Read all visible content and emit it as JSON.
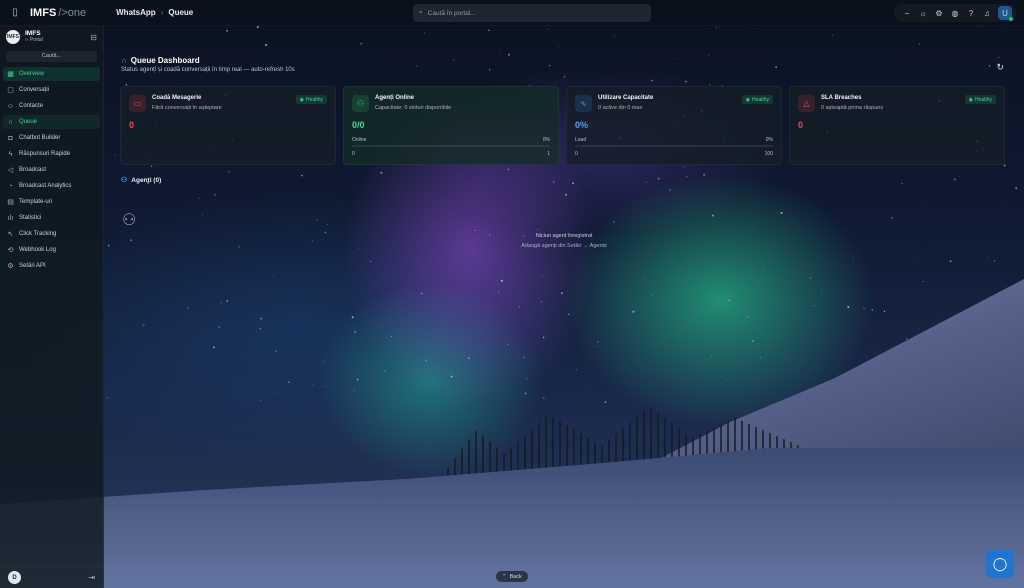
{
  "topbar": {
    "logo_main": "IMFS",
    "logo_suffix": "/>one",
    "breadcrumb": [
      "WhatsApp",
      "Queue"
    ],
    "search_placeholder": "Caută în portal..."
  },
  "sidebar": {
    "brand_name": "IMFS",
    "brand_logo_text": "IMFS",
    "brand_sub": "Portal",
    "search_label": "Caută...",
    "items": [
      {
        "label": "Overview",
        "icon": "grid-icon"
      },
      {
        "label": "Conversații",
        "icon": "chat-icon"
      },
      {
        "label": "Contacte",
        "icon": "contacts-icon"
      },
      {
        "label": "Queue",
        "icon": "headset-icon"
      },
      {
        "label": "Chatbot Builder",
        "icon": "bot-icon"
      },
      {
        "label": "Răspunsuri Rapide",
        "icon": "bolt-icon"
      },
      {
        "label": "Broadcast",
        "icon": "megaphone-icon"
      },
      {
        "label": "Broadcast Analytics",
        "icon": "analytics-icon"
      },
      {
        "label": "Template-uri",
        "icon": "document-icon"
      },
      {
        "label": "Statistici",
        "icon": "bar-chart-icon"
      },
      {
        "label": "Click Tracking",
        "icon": "cursor-icon"
      },
      {
        "label": "Webhook Log",
        "icon": "webhook-icon"
      },
      {
        "label": "Setări API",
        "icon": "settings-icon"
      }
    ],
    "user_initial": "D"
  },
  "user": {
    "initial": "U"
  },
  "dashboard": {
    "title": "Queue Dashboard",
    "subtitle": "Status agenți și coadă conversații în timp real — auto-refresh 10s"
  },
  "cards": [
    {
      "title": "Coadă Mesagerie",
      "desc": "Fără conversații în așteptare",
      "badge": "Healthy",
      "value": "0"
    },
    {
      "title": "Agenți Online",
      "desc": "Capacitate: 0 sloturi disponibile",
      "value": "0/0",
      "row1_left": "Online",
      "row1_right": "0%",
      "row2_left": "0",
      "row2_right": "1"
    },
    {
      "title": "Utilizare Capacitate",
      "desc": "0 active din 0 max",
      "badge": "Healthy",
      "value": "0%",
      "row1_left": "Load",
      "row1_right": "0%",
      "row2_left": "0",
      "row2_right": "100"
    },
    {
      "title": "SLA Breaches",
      "desc": "0 așteaptă prima răspuns",
      "badge": "Healthy",
      "value": "0"
    }
  ],
  "agents": {
    "title": "Agenți (0)",
    "empty_line1": "Niciun agent înregistrat",
    "empty_line2": "Adaugă agenți din Setări → Agents"
  },
  "footer": {
    "back_label": "Back"
  },
  "colors": {
    "accent_green": "#3bd699",
    "accent_red": "#ee4b56",
    "accent_blue": "#4fa3f7",
    "chat_fab": "#2274d1"
  }
}
